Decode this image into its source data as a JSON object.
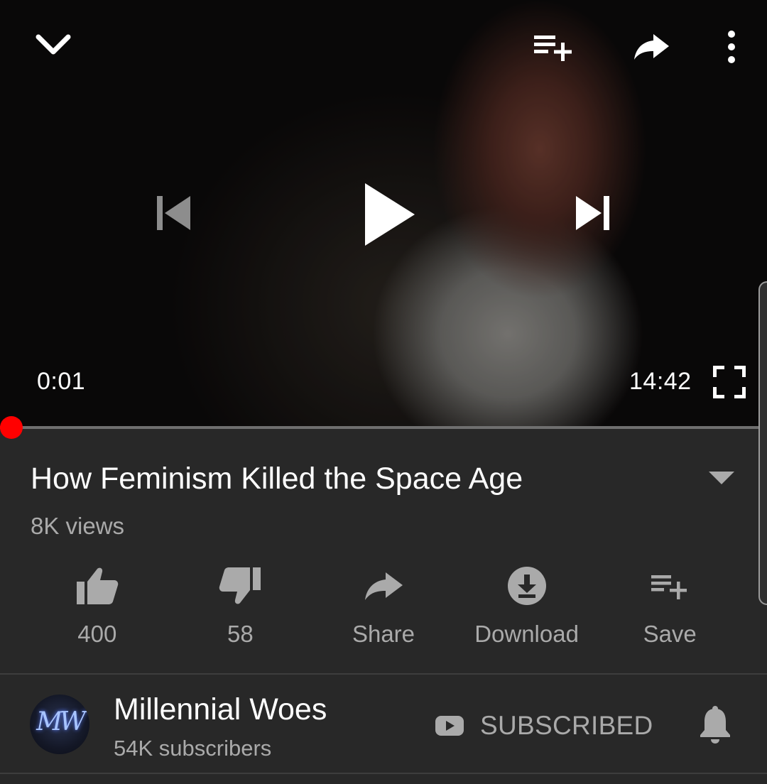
{
  "player": {
    "current_time": "0:01",
    "duration": "14:42",
    "progress_fraction": 0.0012,
    "progress_color": "#ff0000"
  },
  "video": {
    "title": "How Feminism Killed the Space Age",
    "views": "8K views"
  },
  "actions": [
    {
      "name": "like",
      "icon": "thumbs-up-icon",
      "label": "400"
    },
    {
      "name": "dislike",
      "icon": "thumbs-down-icon",
      "label": "58"
    },
    {
      "name": "share",
      "icon": "share-icon",
      "label": "Share"
    },
    {
      "name": "download",
      "icon": "download-icon",
      "label": "Download"
    },
    {
      "name": "save",
      "icon": "playlist-add-icon",
      "label": "Save"
    }
  ],
  "channel": {
    "name": "Millennial Woes",
    "subscribers": "54K subscribers",
    "avatar_monogram": "MW",
    "subscribe_label": "SUBSCRIBED"
  },
  "colors": {
    "background": "#282828",
    "text_primary": "#ffffff",
    "text_secondary": "#aaaaaa"
  }
}
